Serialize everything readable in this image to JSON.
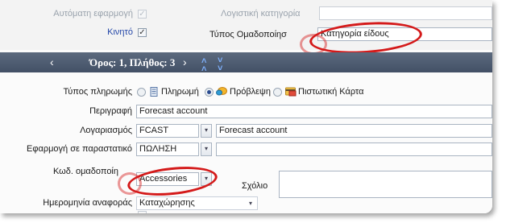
{
  "top": {
    "auto_apply_label": "Αυτόματη εφαρμογή",
    "auto_apply_checked": "✓",
    "mobile_label": "Κινητό",
    "mobile_checked": "✓",
    "accounting_category_label": "Λογιστική κατηγορία",
    "accounting_category_value": "",
    "grouping_type_label": "Τύπος Ομαδοποίησ",
    "grouping_type_value": "Κατηγορία είδους"
  },
  "navbar": {
    "back_icon": "chevron-left-icon",
    "term_text": "Όρος: 1, Πλήθος: 3",
    "forward_icon": "chevron-right-icon",
    "first_icon": "double-chevron-up-icon",
    "last_icon": "double-chevron-down-icon"
  },
  "payment": {
    "label": "Τύπος πληρωμής",
    "options": [
      {
        "label": "Πληρωμή",
        "selected": false,
        "icon": "document-icon"
      },
      {
        "label": "Πρόβλεψη",
        "selected": true,
        "icon": "forecast-icon"
      },
      {
        "label": "Πιστωτική Κάρτα",
        "selected": false,
        "icon": "credit-card-icon"
      }
    ]
  },
  "form": {
    "description_label": "Περιγραφή",
    "description_value": "Forecast account",
    "account_label": "Λογαριασμός",
    "account_code": "FCAST",
    "account_name": "Forecast account",
    "doc_apply_label": "Εφαρμογή σε παραστατικό",
    "doc_apply_value": "ΠΩΛΗΣΗ",
    "group_code_label": "Κωδ. ομαδοποίη",
    "group_code_value": "Accessories",
    "comment_label": "Σχόλιο",
    "ref_date_label": "Ημερομηνία αναφοράς",
    "ref_date_value": "Καταχώρησης"
  },
  "colors": {
    "highlight_ring": "#d41a1a",
    "navbar_bg": "#4c596e",
    "label_blue": "#2346a8"
  }
}
